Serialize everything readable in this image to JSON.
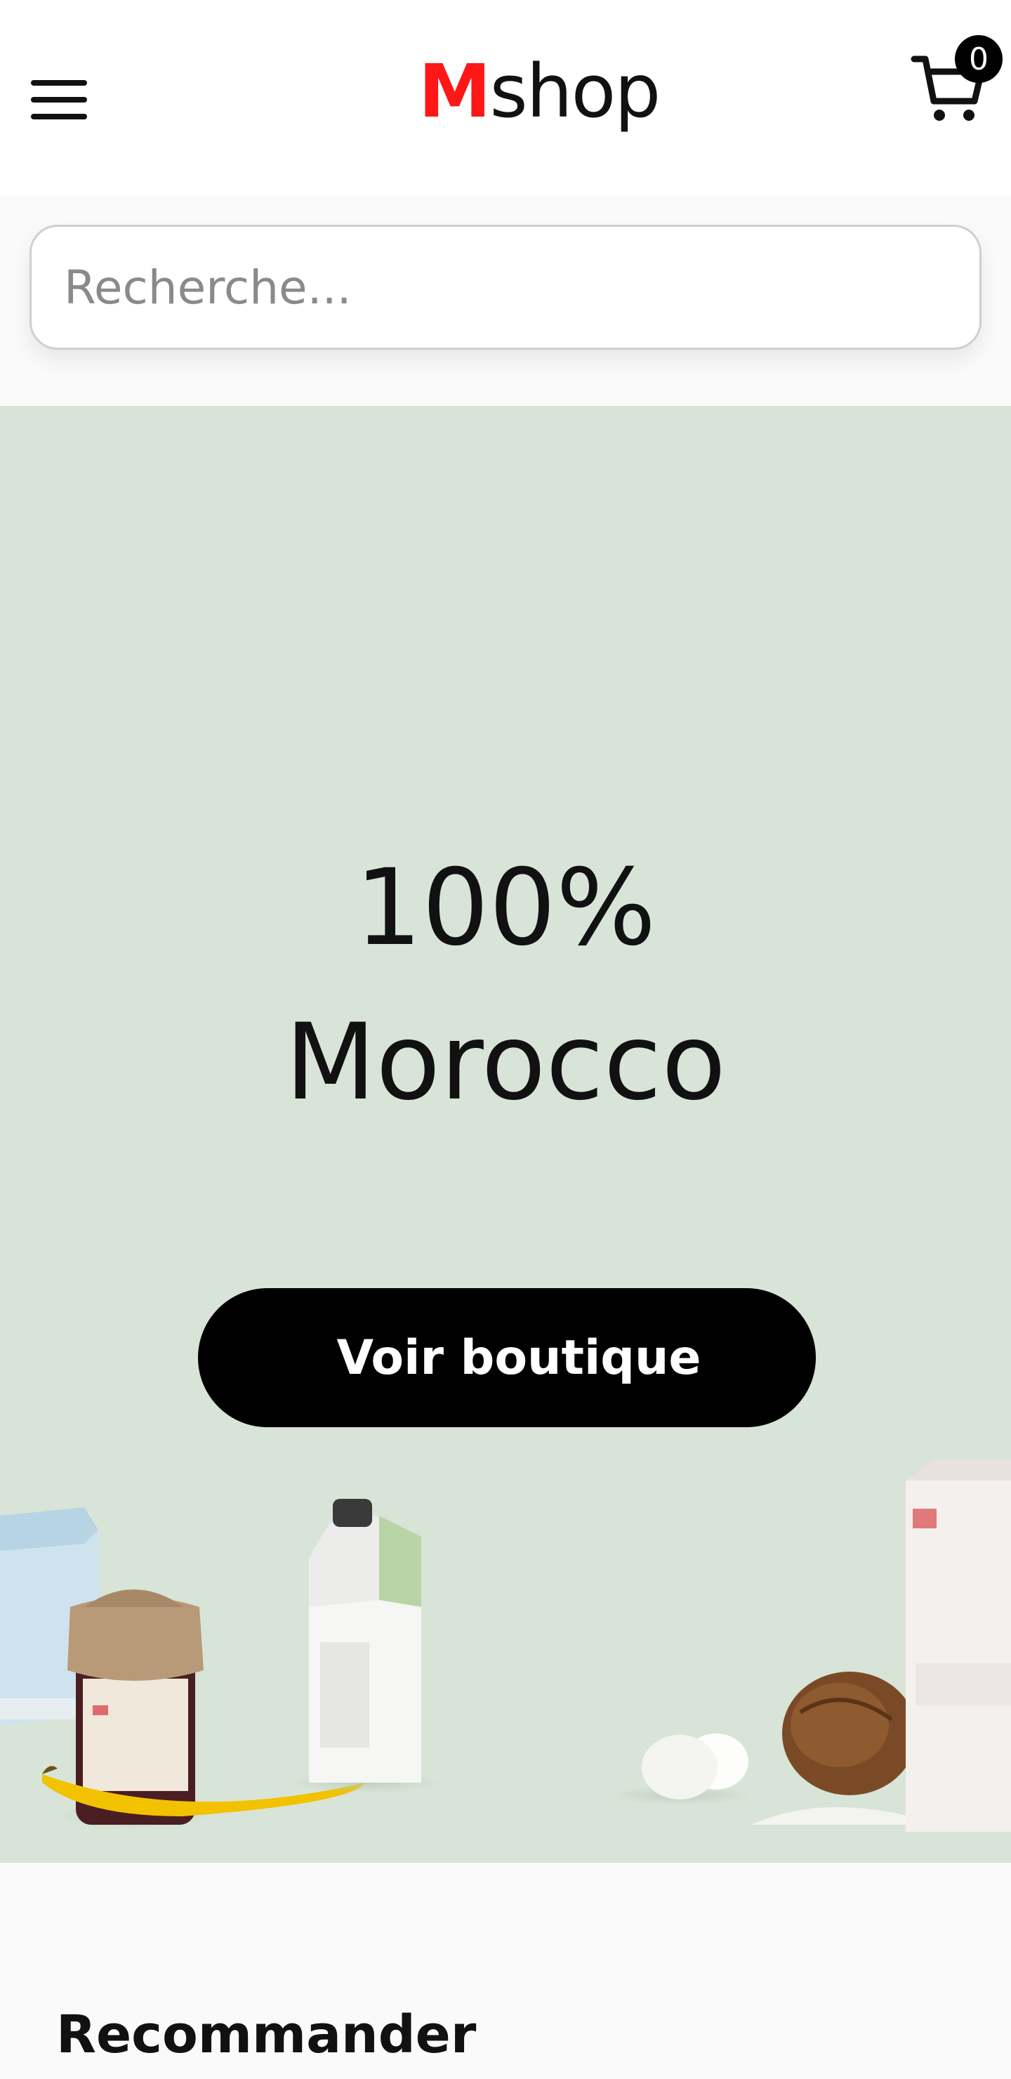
{
  "header": {
    "logo_accent": "M",
    "logo_rest": "shop",
    "cart_count": "0"
  },
  "search": {
    "placeholder": "Recherche..."
  },
  "hero": {
    "line1": "100%",
    "line2": "Morocco",
    "cta_label": "Voir boutique",
    "background_color": "#d8e4d7"
  },
  "section": {
    "title": "Recommander"
  },
  "colors": {
    "accent": "#ff1616",
    "text": "#111111",
    "button": "#000000"
  },
  "icons": [
    "hamburger-menu-icon",
    "shopping-cart-icon"
  ]
}
